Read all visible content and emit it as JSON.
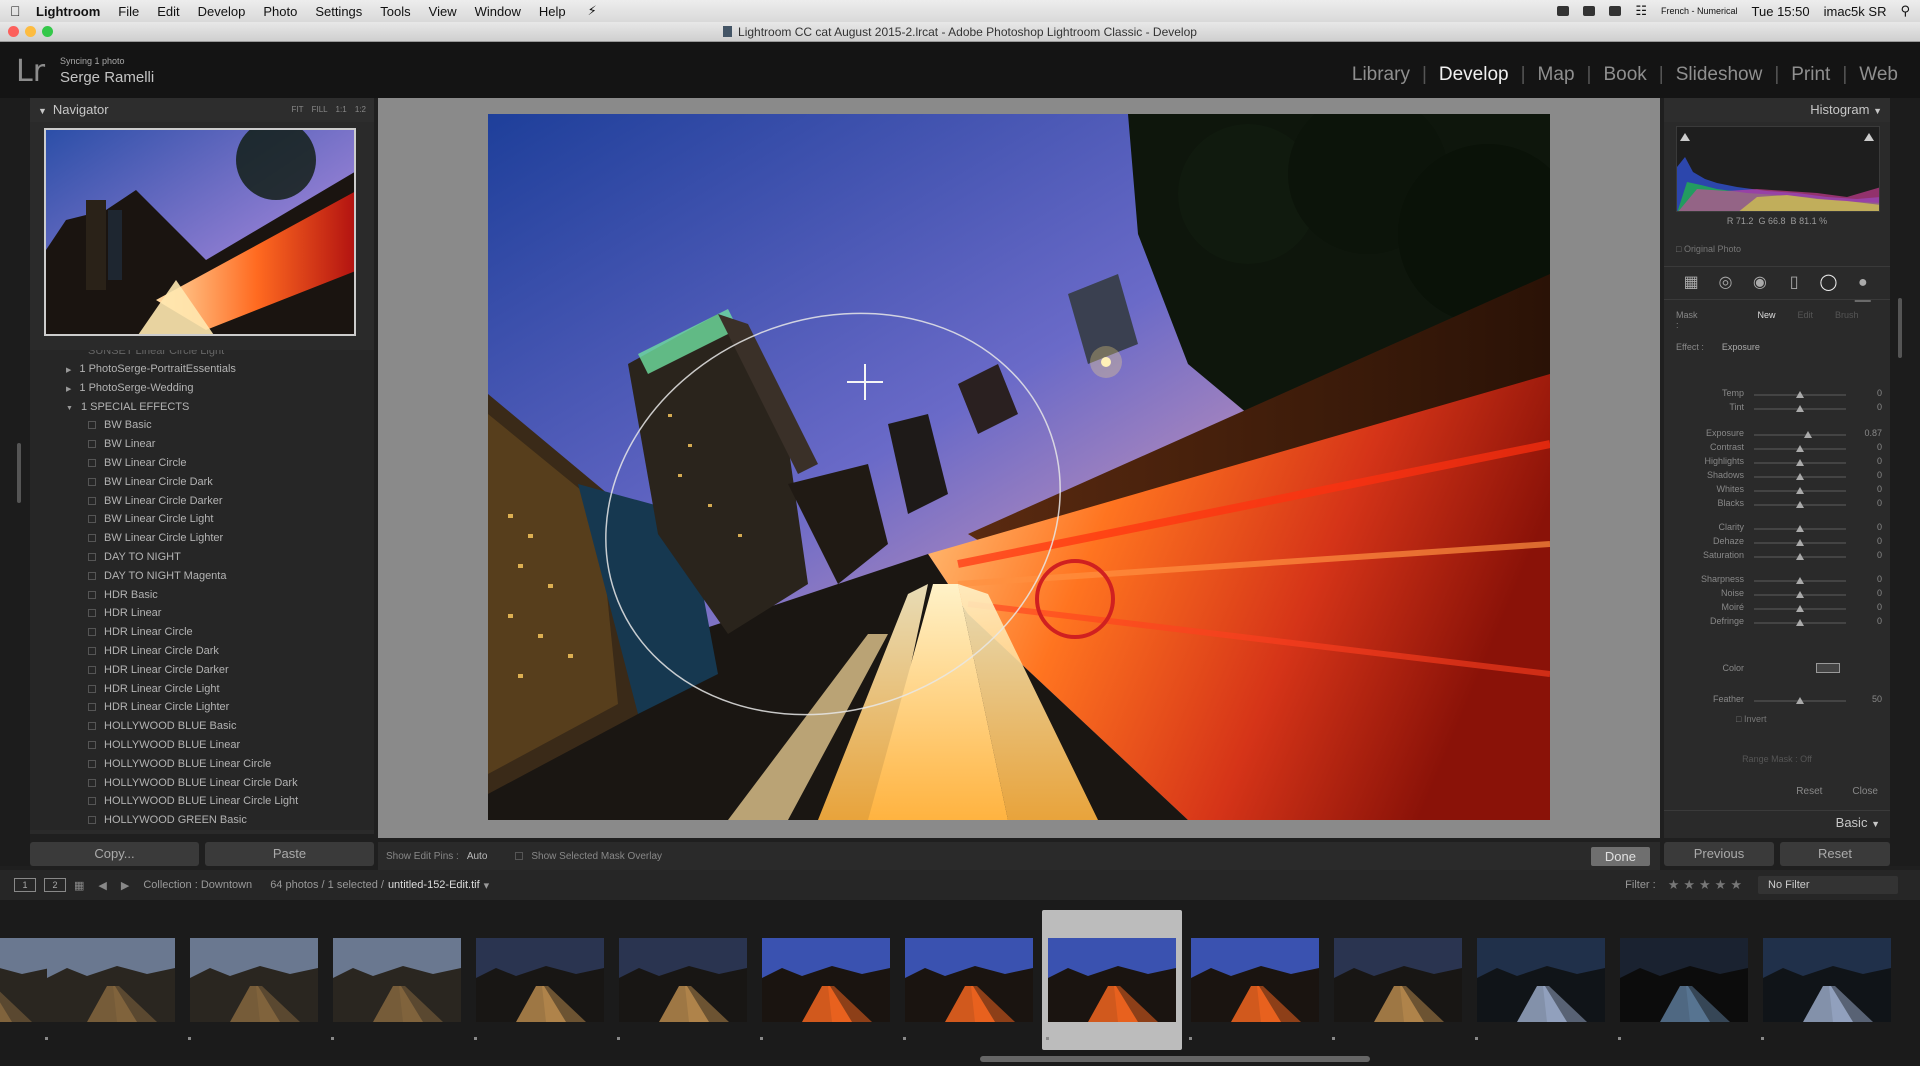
{
  "mac_menubar": {
    "app_name": "Lightroom",
    "menus": [
      "File",
      "Edit",
      "Develop",
      "Photo",
      "Settings",
      "Tools",
      "View",
      "Window",
      "Help"
    ],
    "keyboard": "French - Numerical",
    "time": "Tue 15:50",
    "machine": "imac5k SR"
  },
  "window": {
    "title": "Lightroom CC cat August 2015-2.lrcat - Adobe Photoshop Lightroom Classic - Develop"
  },
  "identity": {
    "logo": "Lr",
    "sync_status": "Syncing 1 photo",
    "user_name": "Serge Ramelli"
  },
  "modules": {
    "items": [
      "Library",
      "Develop",
      "Map",
      "Book",
      "Slideshow",
      "Print",
      "Web"
    ],
    "active": "Develop"
  },
  "navigator": {
    "title": "Navigator",
    "zoom_options": "FIT FILL 1:1 1:2"
  },
  "presets": {
    "top_clip": "SUNSET Linear Circle Light",
    "folders": [
      "1 PhotoSerge-PortraitEssentials",
      "1 PhotoSerge-Wedding",
      "1 SPECIAL EFFECTS"
    ],
    "items": [
      "BW Basic",
      "BW Linear",
      "BW Linear Circle",
      "BW Linear Circle Dark",
      "BW Linear Circle Darker",
      "BW Linear Circle Light",
      "BW Linear Circle Lighter",
      "DAY TO NIGHT",
      "DAY TO NIGHT Magenta",
      "HDR Basic",
      "HDR Linear",
      "HDR Linear Circle",
      "HDR Linear Circle Dark",
      "HDR Linear Circle Darker",
      "HDR Linear Circle Light",
      "HDR Linear Circle Lighter",
      "HOLLYWOOD BLUE Basic",
      "HOLLYWOOD BLUE Linear",
      "HOLLYWOOD BLUE Linear Circle",
      "HOLLYWOOD BLUE Linear Circle Dark",
      "HOLLYWOOD BLUE Linear Circle Light",
      "HOLLYWOOD GREEN Basic"
    ]
  },
  "left_buttons": {
    "copy": "Copy...",
    "paste": "Paste"
  },
  "toolbar": {
    "show_edit_pins_label": "Show Edit Pins :",
    "show_edit_pins_value": "Auto",
    "overlay_label": "Show Selected Mask Overlay",
    "done": "Done"
  },
  "histogram": {
    "title": "Histogram",
    "r_label": "R",
    "r_value": "71.2",
    "g_label": "G",
    "g_value": "66.8",
    "b_label": "B",
    "b_value": "81.1 %",
    "original_photo": "Original Photo"
  },
  "mask": {
    "label": "Mask :",
    "new": "New",
    "edit": "Edit",
    "brush": "Brush"
  },
  "effect": {
    "label": "Effect :",
    "value": "Exposure"
  },
  "sliders": [
    {
      "label": "Temp",
      "value": "0",
      "pos": 0.5
    },
    {
      "label": "Tint",
      "value": "0",
      "pos": 0.5
    },
    {
      "label": "Exposure",
      "value": "0.87",
      "pos": 0.59
    },
    {
      "label": "Contrast",
      "value": "0",
      "pos": 0.5
    },
    {
      "label": "Highlights",
      "value": "0",
      "pos": 0.5
    },
    {
      "label": "Shadows",
      "value": "0",
      "pos": 0.5
    },
    {
      "label": "Whites",
      "value": "0",
      "pos": 0.5
    },
    {
      "label": "Blacks",
      "value": "0",
      "pos": 0.5
    },
    {
      "label": "Clarity",
      "value": "0",
      "pos": 0.5
    },
    {
      "label": "Dehaze",
      "value": "0",
      "pos": 0.5
    },
    {
      "label": "Saturation",
      "value": "0",
      "pos": 0.5
    },
    {
      "label": "Sharpness",
      "value": "0",
      "pos": 0.5
    },
    {
      "label": "Noise",
      "value": "0",
      "pos": 0.5
    },
    {
      "label": "Moiré",
      "value": "0",
      "pos": 0.5
    },
    {
      "label": "Defringe",
      "value": "0",
      "pos": 0.5
    }
  ],
  "color_label": "Color",
  "feather": {
    "label": "Feather",
    "value": "50",
    "pos": 0.5
  },
  "invert_label": "Invert",
  "range_mask": "Range Mask : Off",
  "panel_actions": {
    "reset": "Reset",
    "close": "Close"
  },
  "basic_title": "Basic",
  "right_buttons": {
    "previous": "Previous",
    "reset": "Reset"
  },
  "filmstrip_bar": {
    "monitor1": "1",
    "monitor2": "2",
    "collection": "Collection : Downtown",
    "count": "64 photos / 1 selected /",
    "filename": "untitled-152-Edit.tif",
    "filter_label": "Filter :",
    "filter_value": "No Filter"
  },
  "thumbnails": [
    {
      "style": "dusk"
    },
    {
      "style": "dusk"
    },
    {
      "style": "dusk"
    },
    {
      "style": "dusk"
    },
    {
      "style": "night"
    },
    {
      "style": "night"
    },
    {
      "style": "warm"
    },
    {
      "style": "warm"
    },
    {
      "style": "warm",
      "selected": true
    },
    {
      "style": "warm"
    },
    {
      "style": "night"
    },
    {
      "style": "blue"
    },
    {
      "style": "bridge"
    },
    {
      "style": "blue"
    }
  ]
}
